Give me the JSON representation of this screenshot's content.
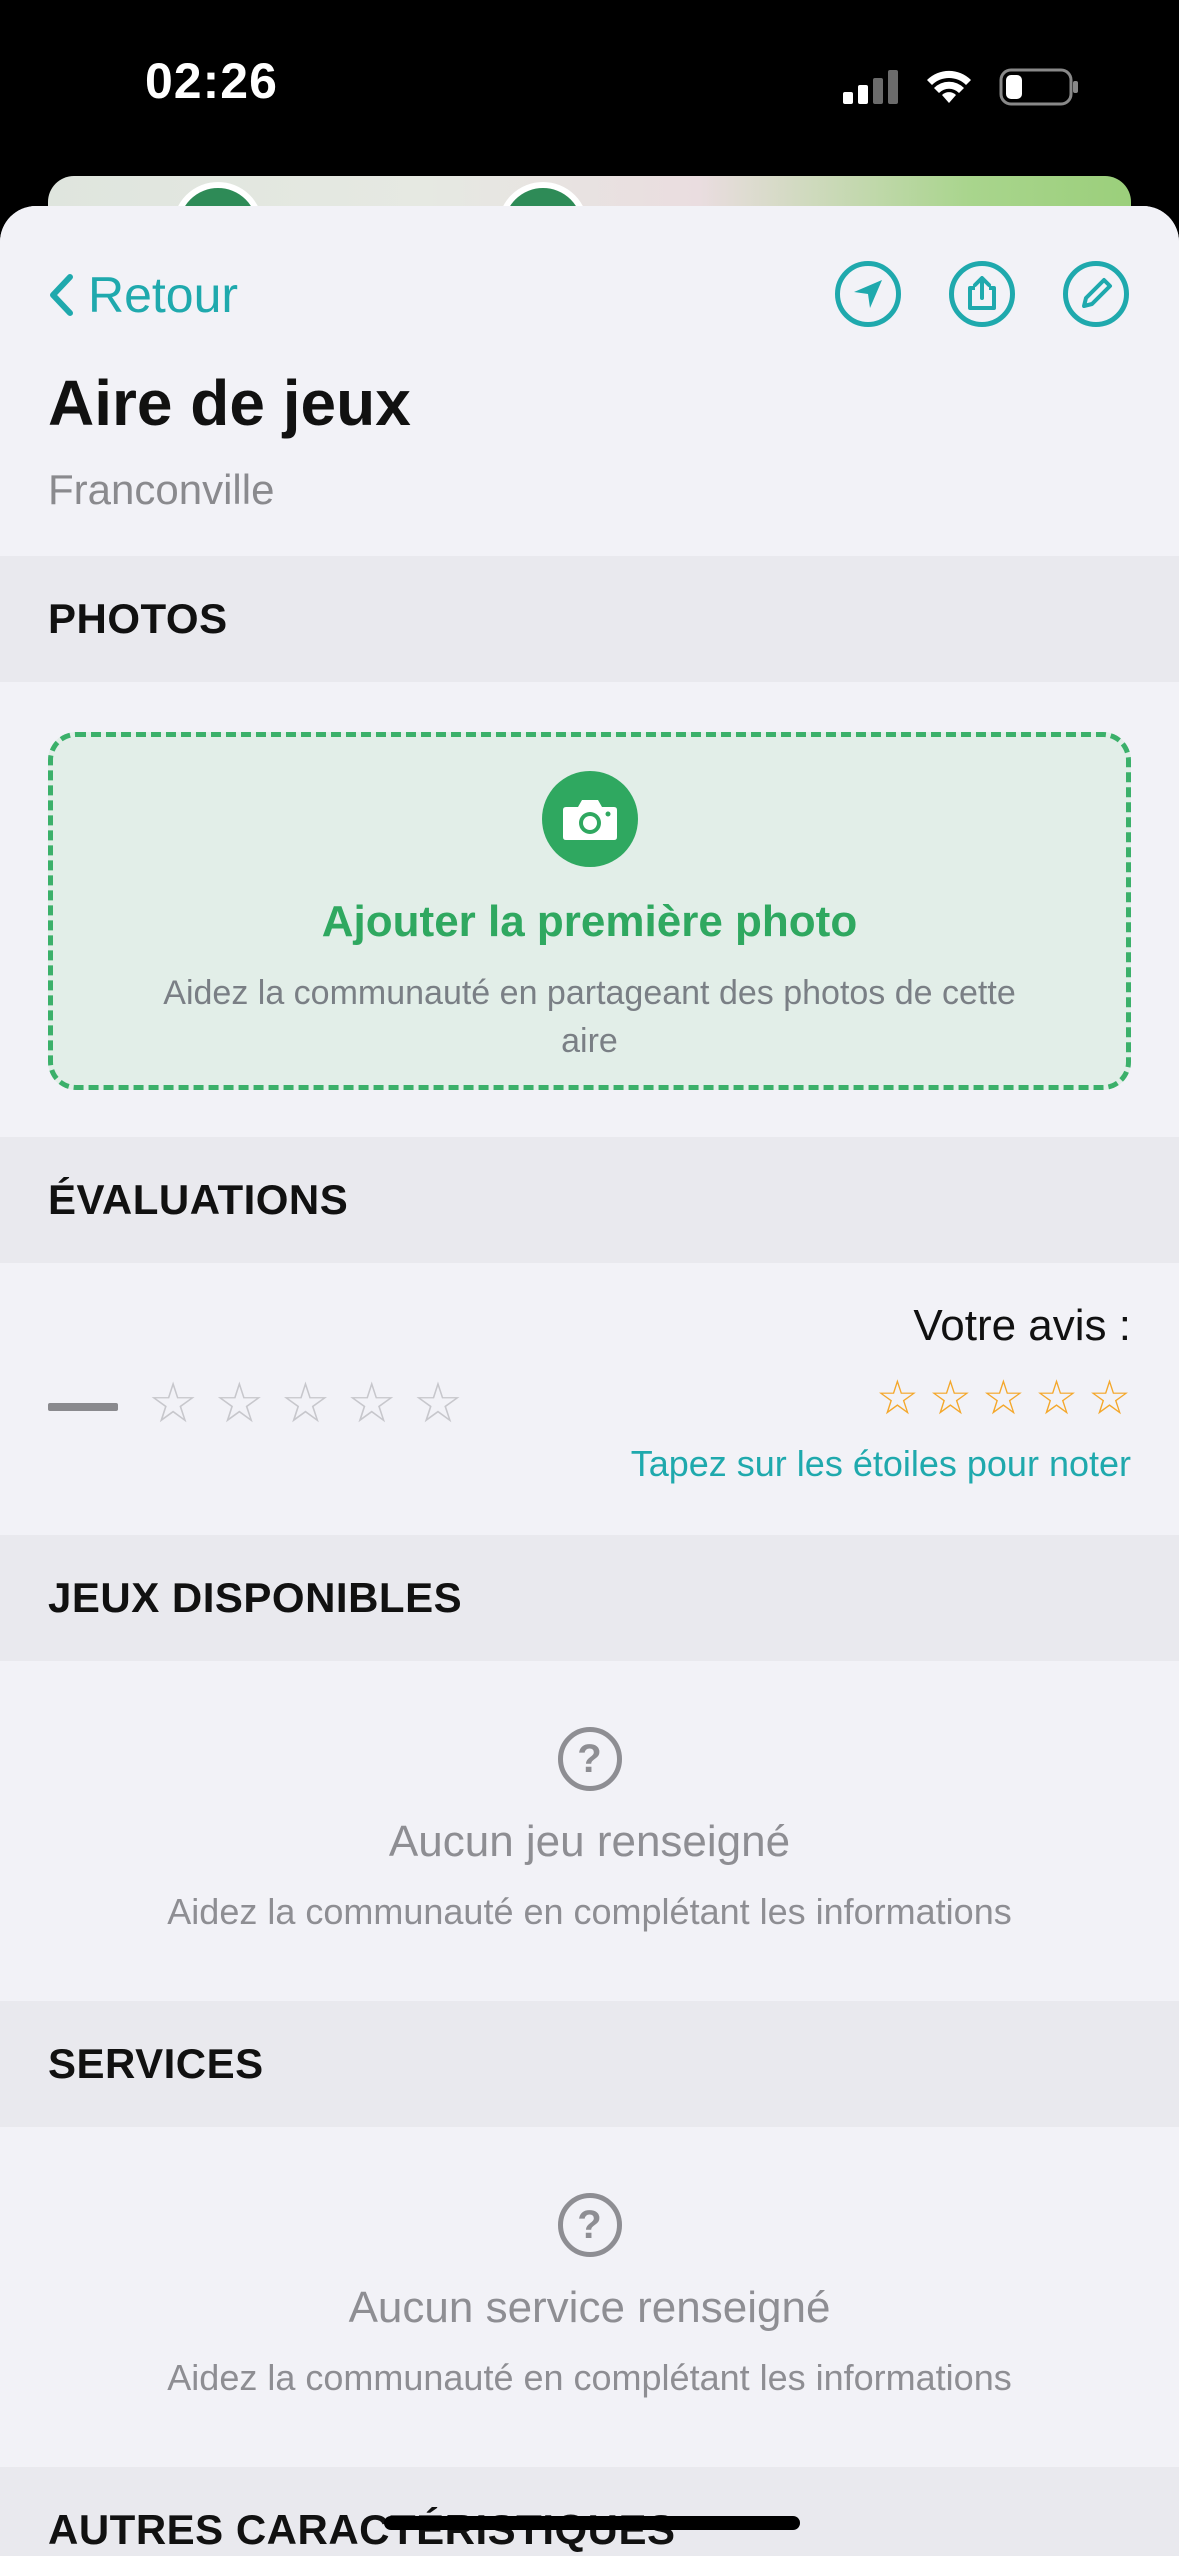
{
  "status": {
    "time": "02:26"
  },
  "header": {
    "back_label": "Retour",
    "title": "Aire de jeux",
    "subtitle": "Franconville",
    "actions": [
      "location-arrow-icon",
      "share-icon",
      "edit-pencil-icon"
    ]
  },
  "photos": {
    "section_title": "PHOTOS",
    "add_title": "Ajouter la première photo",
    "add_help": "Aidez la communauté en partageant des photos de cette aire"
  },
  "evaluations": {
    "section_title": "ÉVALUATIONS",
    "average_placeholder": "—",
    "your_review_label": "Votre avis :",
    "tap_hint": "Tapez sur les étoiles pour noter"
  },
  "jeux": {
    "section_title": "JEUX DISPONIBLES",
    "empty_title": "Aucun jeu renseigné",
    "empty_help": "Aidez la communauté en complétant les informations"
  },
  "services": {
    "section_title": "SERVICES",
    "empty_title": "Aucun service renseigné",
    "empty_help": "Aidez la communauté en complétant les informations"
  },
  "autres": {
    "section_title": "AUTRES CARACTÉRISTIQUES"
  },
  "colors": {
    "accent": "#1fa9ad",
    "green": "#2fa860",
    "star": "#f4a72a"
  }
}
